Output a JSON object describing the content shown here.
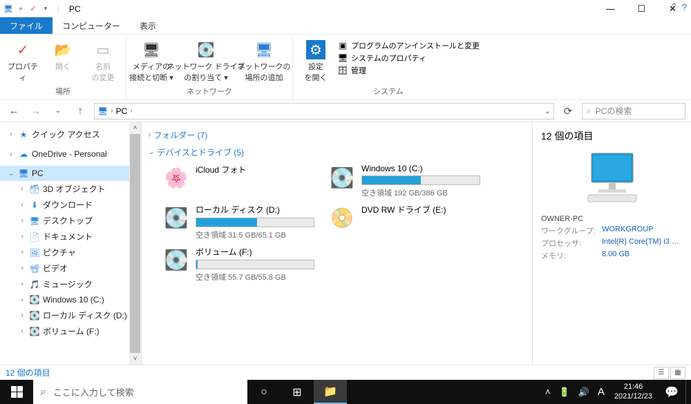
{
  "titlebar": {
    "title": "PC"
  },
  "winbtns": {
    "min": "—",
    "max": "☐",
    "close": "✕"
  },
  "menu": {
    "file": "ファイル",
    "computer": "コンピューター",
    "view": "表示"
  },
  "ribbon": {
    "place": {
      "label": "場所",
      "properties": "プロパティ",
      "open": "開く",
      "rename": "名前\nの変更"
    },
    "network": {
      "label": "ネットワーク",
      "media": "メディアの\n接続と切断 ▾",
      "netdrive": "ネットワーク ドライブ\nの割り当て ▾",
      "netloc": "ネットワークの\n場所の追加"
    },
    "system": {
      "label": "システム",
      "settings": "設定\nを開く",
      "programs": "プログラムのアンインストールと変更",
      "sysprops": "システムのプロパティ",
      "manage": "管理"
    }
  },
  "nav": {
    "back": "←",
    "fwd": "→",
    "up": "↑",
    "refresh": "⟳"
  },
  "breadcrumb": {
    "root": "PC",
    "sep": "›"
  },
  "search": {
    "placeholder": "PCの検索"
  },
  "tree": {
    "quick": "クイック アクセス",
    "onedrive": "OneDrive - Personal",
    "pc": "PC",
    "children": [
      "3D オブジェクト",
      "ダウンロード",
      "デスクトップ",
      "ドキュメント",
      "ピクチャ",
      "ビデオ",
      "ミュージック",
      "Windows 10 (C:)",
      "ローカル ディスク (D:)",
      "ボリューム (F:)"
    ]
  },
  "groups": {
    "folders": "フォルダー (7)",
    "devices": "デバイスとドライブ (5)"
  },
  "drives": [
    {
      "name": "iCloud フォト",
      "free": "",
      "pct": 0,
      "icon": "photo"
    },
    {
      "name": "Windows 10 (C:)",
      "free": "空き領域 192 GB/386 GB",
      "pct": 50,
      "icon": "disk"
    },
    {
      "name": "ローカル ディスク (D:)",
      "free": "空き領域 31.5 GB/65.1 GB",
      "pct": 52,
      "icon": "disk"
    },
    {
      "name": "DVD RW ドライブ (E:)",
      "free": "",
      "pct": 0,
      "icon": "dvd"
    },
    {
      "name": "ボリューム (F:)",
      "free": "空き領域 55.7 GB/55.8 GB",
      "pct": 1,
      "icon": "disk"
    }
  ],
  "details": {
    "title": "12 個の項目",
    "owner": "OWNER-PC",
    "workgroup_k": "ワークグループ:",
    "workgroup_v": "WORKGROUP",
    "cpu_k": "プロセッサ:",
    "cpu_v": "Intel(R) Core(TM) i3 C…",
    "mem_k": "メモリ:",
    "mem_v": "8.00 GB"
  },
  "status": {
    "count": "12 個の項目"
  },
  "taskbar": {
    "search_placeholder": "ここに入力して検索",
    "time": "21:46",
    "date": "2021/12/23",
    "ime": "A"
  }
}
